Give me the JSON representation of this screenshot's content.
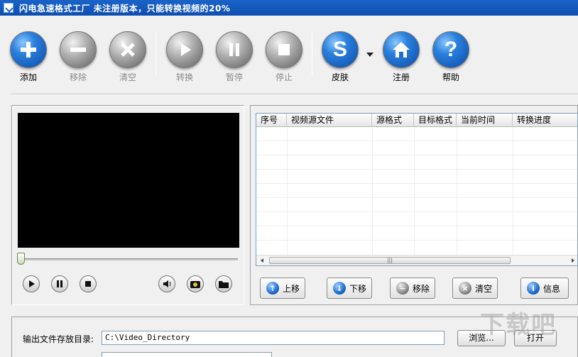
{
  "window": {
    "title": "闪电急速格式工厂   未注册版本，只能转换视频的20%"
  },
  "toolbar": {
    "add": "添加",
    "remove": "移除",
    "clear": "清空",
    "convert": "转换",
    "pause": "暂停",
    "stop": "停止",
    "skin": "皮肤",
    "register": "注册",
    "help": "帮助"
  },
  "file_list": {
    "columns": [
      "序号",
      "视频源文件",
      "源格式",
      "目标格式",
      "当前时间",
      "转换进度"
    ],
    "rows": []
  },
  "list_actions": {
    "move_up": "上移",
    "move_down": "下移",
    "remove": "移除",
    "clear": "清空",
    "info": "信息"
  },
  "output": {
    "label": "输出文件存放目录:",
    "path": "C:\\Video_Directory",
    "browse": "浏览...",
    "open": "打开"
  },
  "watermark": "下载吧"
}
